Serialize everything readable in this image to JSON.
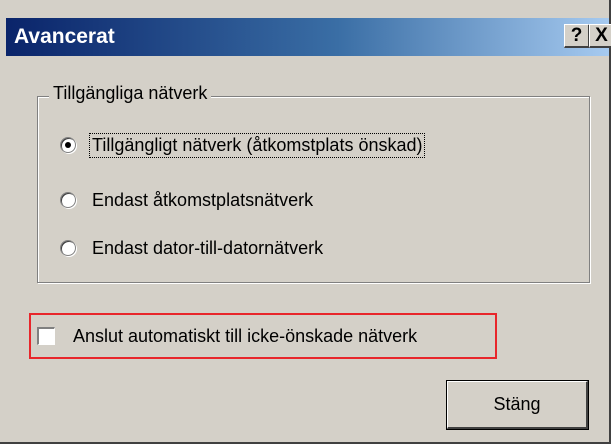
{
  "window": {
    "title": "Avancerat",
    "help_glyph": "?",
    "close_glyph": "X"
  },
  "network_group": {
    "title": "Tillgängliga nätverk",
    "options": [
      {
        "label": "Tillgängligt nätverk (åtkomstplats önskad)",
        "checked": true
      },
      {
        "label": "Endast åtkomstplatsnätverk",
        "checked": false
      },
      {
        "label": "Endast dator-till-datornätverk",
        "checked": false
      }
    ]
  },
  "auto_connect": {
    "label": "Anslut automatiskt till icke-önskade nätverk",
    "checked": false,
    "highlight_color": "#e8262b"
  },
  "buttons": {
    "close_label": "Stäng"
  },
  "colors": {
    "titlebar_start": "#0a246a",
    "titlebar_end": "#a6caf0",
    "dialog_bg": "#d4d0c8"
  }
}
